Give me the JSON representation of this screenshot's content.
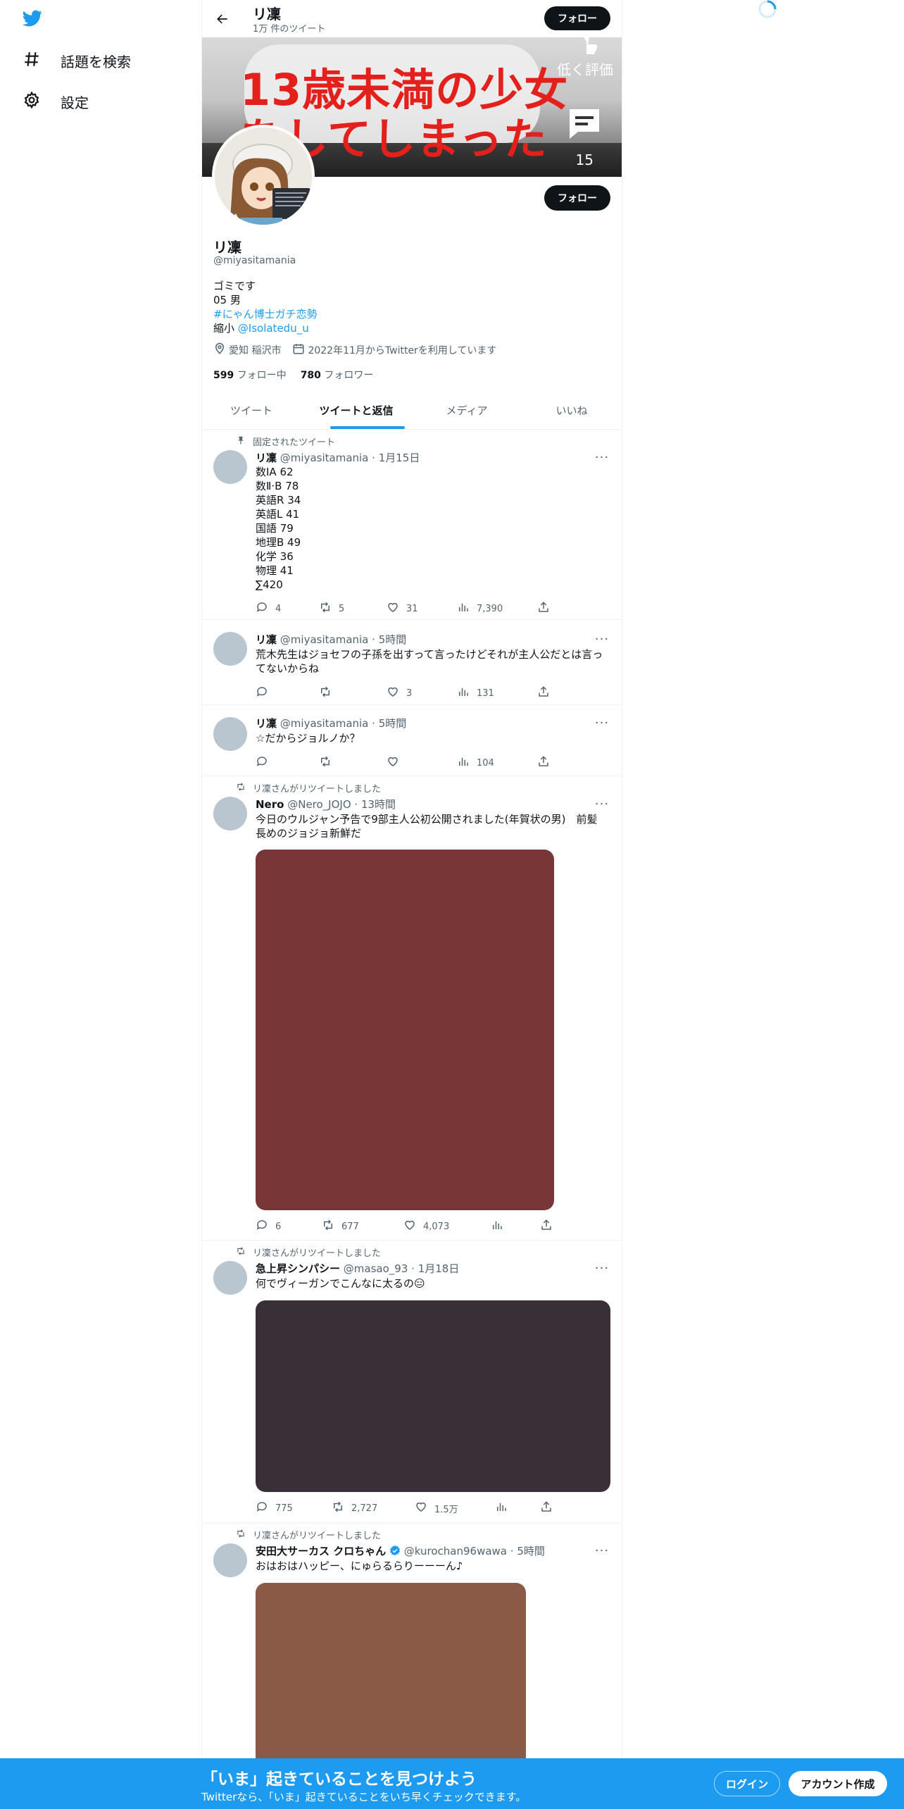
{
  "nav": {
    "items": [
      {
        "label": "話題を検索",
        "icon": "hashtag-icon"
      },
      {
        "label": "設定",
        "icon": "gear-icon"
      }
    ]
  },
  "header": {
    "name": "リ凜",
    "tweet_count": "1万 件のツイート",
    "follow_label": "フォロー"
  },
  "banner": {
    "line1": "13歳未満の少女",
    "line2": "をしてしまった",
    "overlay_label": "低く評価",
    "comment_count": "15"
  },
  "profile": {
    "display_name": "リ凜",
    "handle": "@miyasitamania",
    "follow_label": "フォロー",
    "bio_line1": "ゴミです",
    "bio_line2": "05 男",
    "bio_hashtag": "#にゃん博士ガチ恋勢",
    "bio_line4_prefix": "縮小 ",
    "bio_mention": "@Isolatedu_u",
    "location": "愛知 稲沢市",
    "joined": "2022年11月からTwitterを利用しています",
    "following_count": "599",
    "following_label": "フォロー中",
    "followers_count": "780",
    "followers_label": "フォロワー"
  },
  "tabs": [
    {
      "label": "ツイート",
      "active": false
    },
    {
      "label": "ツイートと返信",
      "active": true
    },
    {
      "label": "メディア",
      "active": false
    },
    {
      "label": "いいね",
      "active": false
    }
  ],
  "tweets": [
    {
      "context": "固定されたツイート",
      "name": "リ凜",
      "handle": "@miyasitamania",
      "time": "1月15日",
      "text": "数ⅠA 62\n数Ⅱ·B 78\n英語R 34\n英語L 41\n国語 79\n地理B 49\n化学 36\n物理 41\n∑420",
      "replies": "4",
      "retweets": "5",
      "likes": "31",
      "views": "7,390"
    },
    {
      "name": "リ凜",
      "handle": "@miyasitamania",
      "time": "5時間",
      "text": "荒木先生はジョセフの子孫を出すって言ったけどそれが主人公だとは言ってないからね",
      "replies": "",
      "retweets": "",
      "likes": "3",
      "views": "131"
    },
    {
      "name": "リ凜",
      "handle": "@miyasitamania",
      "time": "5時間",
      "text": "☆だからジョルノか？",
      "replies": "",
      "retweets": "",
      "likes": "",
      "views": "104"
    },
    {
      "context": "リ凜さんがリツイートしました",
      "name": "Nero",
      "handle": "@Nero_JOJO",
      "time": "13時間",
      "text": "今日のウルジャン予告で9部主人公初公開されました(年賀状の男)　前髪長めのジョジョ新鮮だ",
      "media_color": "#783636",
      "replies": "6",
      "retweets": "677",
      "likes": "4,073",
      "views": ""
    },
    {
      "context": "リ凜さんがリツイートしました",
      "name": "急上昇シンパシー",
      "handle": "@masao_93",
      "time": "1月18日",
      "text": "何でヴィーガンでこんなに太るの😑",
      "media_color": "#383036",
      "replies": "775",
      "retweets": "2,727",
      "likes": "1.5万",
      "views": ""
    },
    {
      "context": "リ凜さんがリツイートしました",
      "name": "安田大サーカス クロちゃん",
      "handle": "@kurochan96wawa",
      "time": "5時間",
      "text": "おはおはハッピー、にゅらるらりーーーん♪",
      "media_color": "#8b5a46"
    }
  ],
  "bottom_bar": {
    "title": "「いま」起きていることを見つけよう",
    "subtitle": "Twitterなら、「いま」起きていることをいち早くチェックできます。",
    "login": "ログイン",
    "signup": "アカウント作成"
  },
  "colors": {
    "accent": "#1d9bf0",
    "text": "#0f1419",
    "secondary": "#536471"
  }
}
